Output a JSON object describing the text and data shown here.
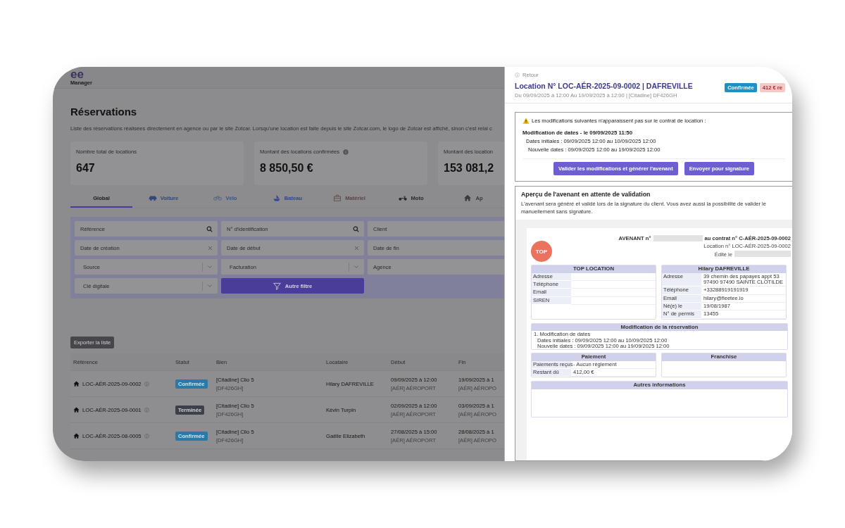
{
  "app": {
    "logo": "ee",
    "logo_sub": "Manager"
  },
  "page": {
    "title": "Réservations",
    "description": "Liste des réservations réalisées directement en agence ou par le site Zotcar. Lorsqu'une location est faite depuis le site Zotcar.com, le logo de Zotcar est affiché, sinon c'est relai c"
  },
  "stats": [
    {
      "label": "Nombre total de locations",
      "value": "647",
      "info": false
    },
    {
      "label": "Montant des locations confirmées",
      "value": "8 850,50 €",
      "info": true
    },
    {
      "label": "Montant des location",
      "value": "153 081,2",
      "info": false
    }
  ],
  "tabs": [
    {
      "label": "Global",
      "kind": "all",
      "color": "#1a1a1a",
      "selected": true
    },
    {
      "label": "Voiture",
      "kind": "car",
      "color": "#33467a",
      "selected": false
    },
    {
      "label": "Vélo",
      "kind": "bike",
      "color": "#3c5680",
      "selected": false
    },
    {
      "label": "Bateau",
      "kind": "boat",
      "color": "#2f4596",
      "selected": false
    },
    {
      "label": "Matériel",
      "kind": "equipment",
      "color": "#5e4444",
      "selected": false
    },
    {
      "label": "Moto",
      "kind": "motorbike",
      "color": "#2a2a2a",
      "selected": false
    },
    {
      "label": "Ap",
      "kind": "home",
      "color": "#3a3a3a",
      "selected": false
    }
  ],
  "filters": [
    {
      "kind": "search",
      "placeholder": "Référence"
    },
    {
      "kind": "search",
      "placeholder": "N° d'identification"
    },
    {
      "kind": "plain",
      "placeholder": "Client"
    },
    {
      "kind": "date",
      "placeholder": "Date de création"
    },
    {
      "kind": "date",
      "placeholder": "Date de début"
    },
    {
      "kind": "plain",
      "placeholder": "Date de fin"
    },
    {
      "kind": "select",
      "placeholder": "Source"
    },
    {
      "kind": "select",
      "placeholder": "Facturation"
    },
    {
      "kind": "plain",
      "placeholder": "Agence"
    },
    {
      "kind": "select",
      "placeholder": "Clé digitale"
    },
    {
      "kind": "button",
      "label": "Autre filtre"
    }
  ],
  "export_button": "Exporter la liste",
  "table": {
    "columns": [
      "Référence",
      "Statut",
      "Bien",
      "Locataire",
      "Début",
      "Fin"
    ],
    "rows": [
      {
        "reference": "LOC-AÉR-2025-09-0002",
        "status": "Confirmée",
        "kind": "confirmed",
        "vehicle": "[Citadine] Clio 5",
        "plate": "[DF426GH]",
        "tenant": "Hilary DAFREVILLE",
        "start": "09/09/2025 à 12:00",
        "start_agency": "[AÉR] AÉROPORT",
        "end": "19/09/2025 à 1",
        "end_agency": "[AÉR] AÉROPO"
      },
      {
        "reference": "LOC-AÉR-2025-09-0001",
        "status": "Terminée",
        "kind": "finished",
        "vehicle": "[Citadine] Clio 5",
        "plate": "[DF426GH]",
        "tenant": "Kévin Turpin",
        "start": "02/09/2025 à 12:00",
        "start_agency": "[AÉR] AÉROPORT",
        "end": "03/09/2025 à 1",
        "end_agency": "[AÉR] AÉROPO"
      },
      {
        "reference": "LOC-AÉR-2025-08-0005",
        "status": "Confirmée",
        "kind": "confirmed",
        "vehicle": "[Citadine] Clio 5",
        "plate": "[DF426GH]",
        "tenant": "Gaëlle Elizabeth",
        "start": "27/08/2025 à 15:00",
        "start_agency": "[AÉR] AÉROPORT",
        "end": "28/08/2025 à 1",
        "end_agency": "[AÉR] AÉROPO"
      }
    ]
  },
  "detail": {
    "back": "Retour",
    "title": "Location N° LOC-AÉR-2025-09-0002 | DAFREVILLE",
    "subtitle": "Du 09/09/2025 à 12:00 Au 19/09/2025 à 12:00 | [Citadine] DF426GH",
    "badges": [
      {
        "label": "Confirmée",
        "kind": "status"
      },
      {
        "label": "412 € re",
        "kind": "due"
      }
    ]
  },
  "alert": {
    "message": "Les modifications suivantes n'apparaissent pas sur le contrat de location :",
    "heading": "Modification de dates - le 09/09/2025 11:50",
    "lines": [
      "Dates initiales : 09/09/2025 12:00 au 10/09/2025 12:00",
      "Nouvelle dates : 09/09/2025 12:00 au 19/09/2025 12:00"
    ],
    "buttons": [
      "Valider les modifications et générer l'avenant",
      "Envoyer pour signature"
    ]
  },
  "preview": {
    "title": "Aperçu de l'avenant en attente de validation",
    "text": "L'avenant sera généré et validé lors de la signature du client. Vous avez aussi la possibilité de valider le manuellement sans signature."
  },
  "document": {
    "logo": "TOP",
    "avenant": "AVENANT n°",
    "contract": "au contrat n° C-AÉR-2025-09-0002",
    "location": "Location n° LOC-AÉR-2025-09-0002",
    "edited": "Édité le",
    "company": {
      "name": "TOP LOCATION",
      "fields": [
        {
          "label": "Adresse"
        },
        {
          "label": "Téléphone"
        },
        {
          "label": "Email"
        },
        {
          "label": "SIREN"
        }
      ]
    },
    "client": {
      "name": "Hilary DAFREVILLE",
      "fields": [
        {
          "label": "Adresse",
          "value": "39 chemin des papayes appt 53 97490 97490 SAINTE CLOTILDE"
        },
        {
          "label": "Téléphone",
          "value": "+33288919191919"
        },
        {
          "label": "Email",
          "value": "hilary@fleetee.io"
        },
        {
          "label": "Né(e) le",
          "value": "19/08/1987"
        },
        {
          "label": "N° de permis",
          "value": "13455"
        }
      ]
    },
    "modification": {
      "title": "Modification de la réservation",
      "item": "1. Modification de dates",
      "lines": [
        "Dates initiales : 09/09/2025 12:00 au 10/09/2025 12:00",
        "Nouvelle dates : 09/09/2025 12:00 au 19/09/2025 12:00"
      ]
    },
    "payment": {
      "title": "Paiement",
      "rows": [
        {
          "label": "Paiements reçus",
          "value": "- Aucun règlement"
        },
        {
          "label": "Restant dû",
          "value": "412,00 €"
        }
      ]
    },
    "franchise": {
      "title": "Franchise"
    },
    "other": {
      "title": "Autres informations"
    }
  }
}
